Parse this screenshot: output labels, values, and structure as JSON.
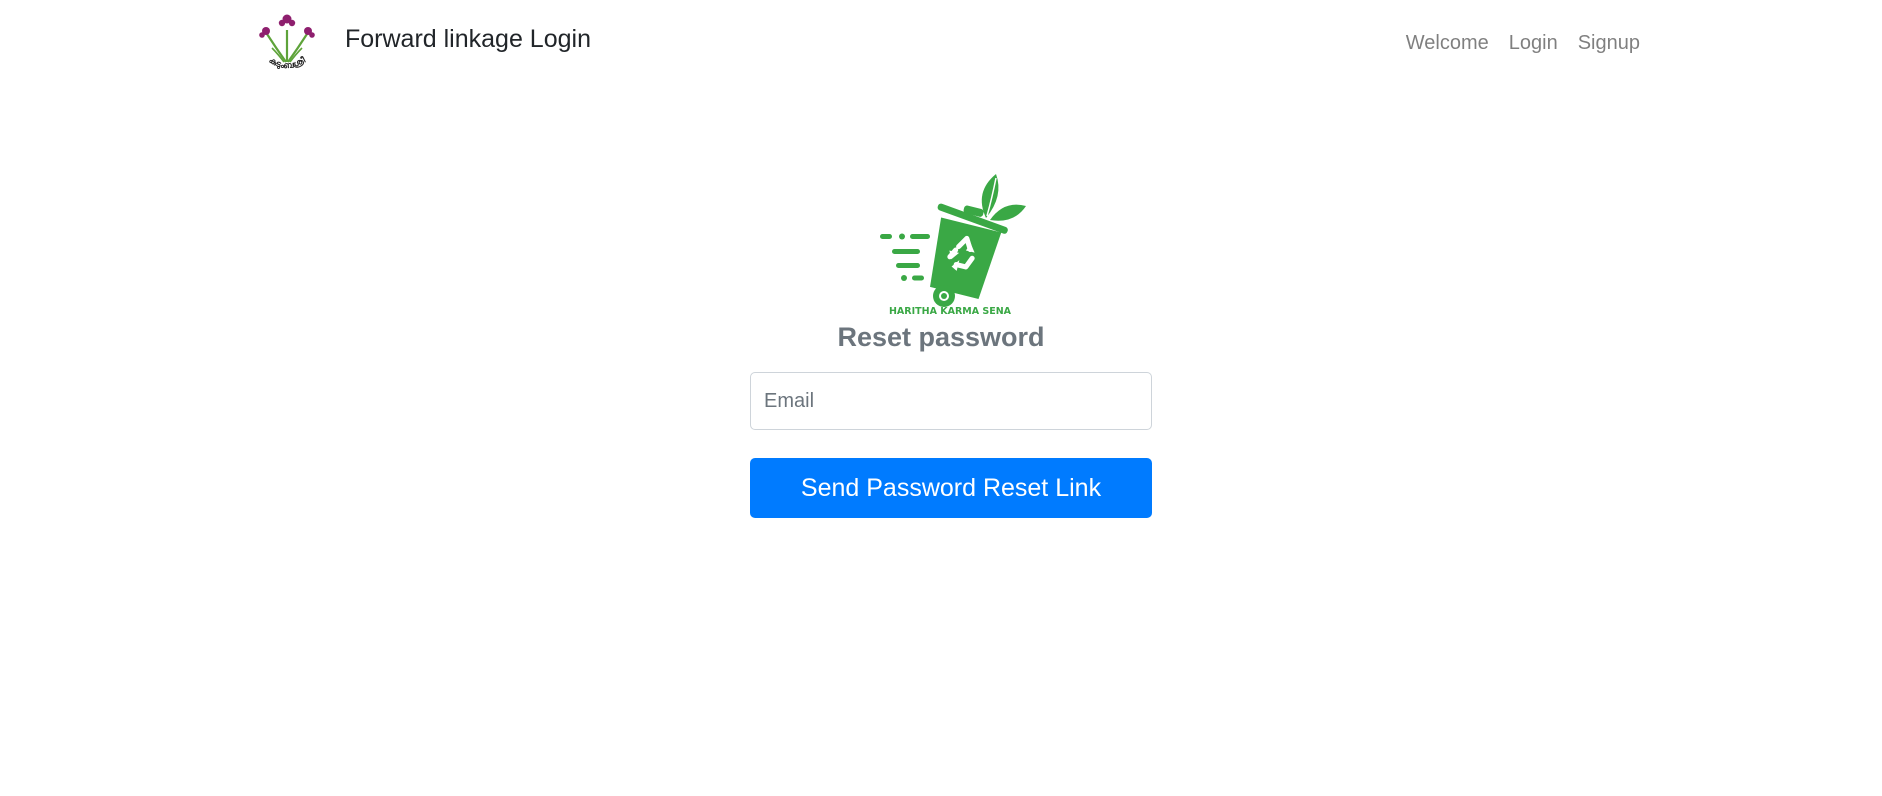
{
  "header": {
    "brand_logo_icon": "kudumbashree-flower-logo",
    "brand_logo_text": "കുടുംബശ്രീ",
    "title": "Forward linkage Login",
    "nav": [
      {
        "label": "Welcome"
      },
      {
        "label": "Login"
      },
      {
        "label": "Signup"
      }
    ]
  },
  "main": {
    "logo_icon": "recycle-bin-leaf-logo",
    "logo_caption": "HARITHA KARMA SENA",
    "title": "Reset password",
    "email": {
      "value": "",
      "placeholder": "Email"
    },
    "submit_label": "Send Password Reset Link"
  },
  "colors": {
    "primary": "#007bff",
    "logo_green": "#3aa845",
    "flower_purple": "#8e1f6e",
    "nav_link": "rgba(0,0,0,0.5)",
    "muted_text": "#6c757d"
  }
}
